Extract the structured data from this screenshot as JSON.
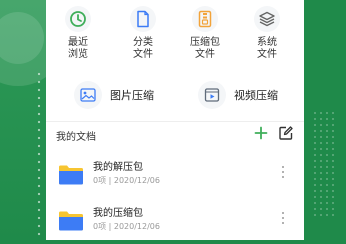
{
  "quick_access": [
    {
      "label": "最近\n浏览",
      "icon": "clock-icon"
    },
    {
      "label": "分类\n文件",
      "icon": "file-icon"
    },
    {
      "label": "压缩包\n文件",
      "icon": "archive-icon"
    },
    {
      "label": "系统\n文件",
      "icon": "layers-icon"
    }
  ],
  "tools": [
    {
      "label": "图片压缩",
      "icon": "image-icon"
    },
    {
      "label": "视频压缩",
      "icon": "video-icon"
    }
  ],
  "docs": {
    "title": "我的文档",
    "files": [
      {
        "name": "我的解压包",
        "meta": "0项 | 2020/12/06"
      },
      {
        "name": "我的压缩包",
        "meta": "0项 | 2020/12/06"
      }
    ]
  },
  "colors": {
    "accent": "#1f8a4a",
    "green": "#3fae5a",
    "orange": "#f2a33a",
    "folder_blue": "#3d7cf5",
    "folder_yellow": "#f7c531"
  }
}
